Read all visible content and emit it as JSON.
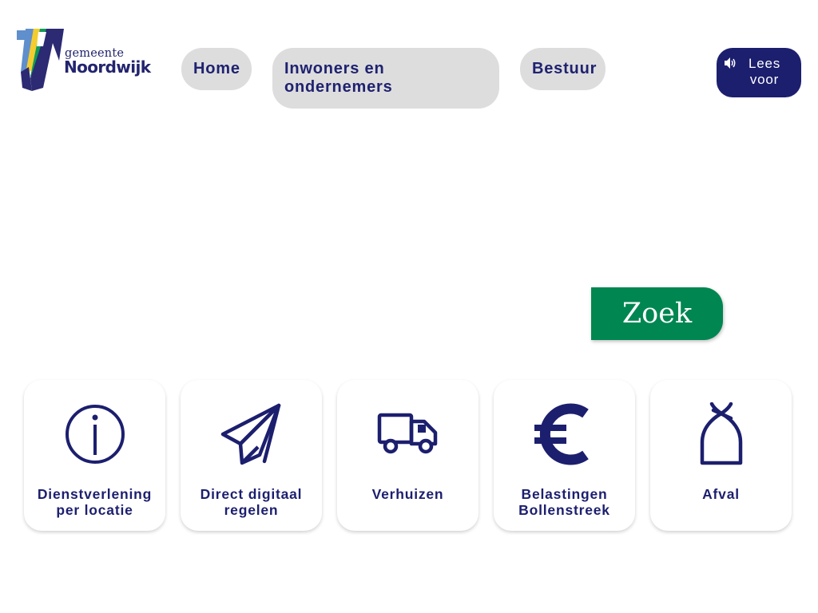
{
  "logo": {
    "small": "gemeente",
    "big": "Noordwijk",
    "colors": {
      "navy": "#22246e",
      "blue": "#5f8fcc",
      "yellow": "#f3cd2f",
      "green": "#0f9a57"
    }
  },
  "nav": [
    {
      "label": "Home"
    },
    {
      "label": "Inwoners en ondernemers"
    },
    {
      "label": "Bestuur"
    }
  ],
  "lees_voor": {
    "label": "Lees voor",
    "icon": "speaker-icon"
  },
  "search": {
    "button_label": "Zoek",
    "button_color": "#008651"
  },
  "tiles": [
    {
      "label": "Dienstverlening per locatie",
      "icon": "info-icon"
    },
    {
      "label": "Direct digitaal regelen",
      "icon": "paper-plane-icon"
    },
    {
      "label": "Verhuizen",
      "icon": "truck-icon"
    },
    {
      "label": "Belastingen Bollenstreek",
      "icon": "euro-icon"
    },
    {
      "label": "Afval",
      "icon": "garbage-bag-icon"
    }
  ],
  "colors": {
    "navy": "#1c1f6e",
    "nav_bg": "#dddddd",
    "green": "#008651"
  }
}
